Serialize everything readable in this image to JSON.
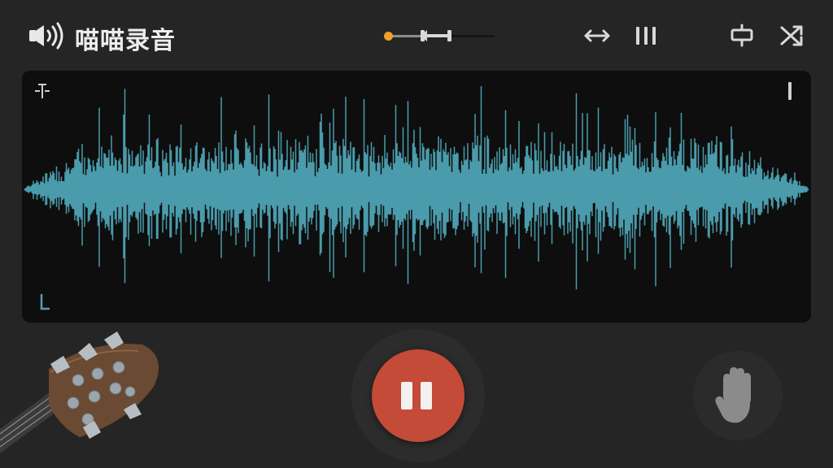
{
  "app": {
    "title": "喵喵录音",
    "accent_color": "#c34b38",
    "waveform_color": "#4a9bab",
    "slider_dot_color": "#f0a028"
  },
  "header": {
    "volume_icon": "speaker-volume-icon",
    "position_slider": {
      "value": 0.58
    },
    "tools": [
      {
        "icon": "stretch-horizontal-icon"
      },
      {
        "icon": "bars-icon"
      },
      {
        "icon": "trim-icon"
      },
      {
        "icon": "shuffle-icon"
      }
    ]
  },
  "waveform": {
    "start_marker_icon": "start-marker-icon",
    "end_marker_icon": "end-marker-icon",
    "corner_marker_icon": "down-marker-icon"
  },
  "controls": {
    "record_button_state": "pause",
    "record_icon": "pause-icon",
    "hand_icon": "hand-icon",
    "decoration_icon": "guitar-headstock-icon"
  }
}
